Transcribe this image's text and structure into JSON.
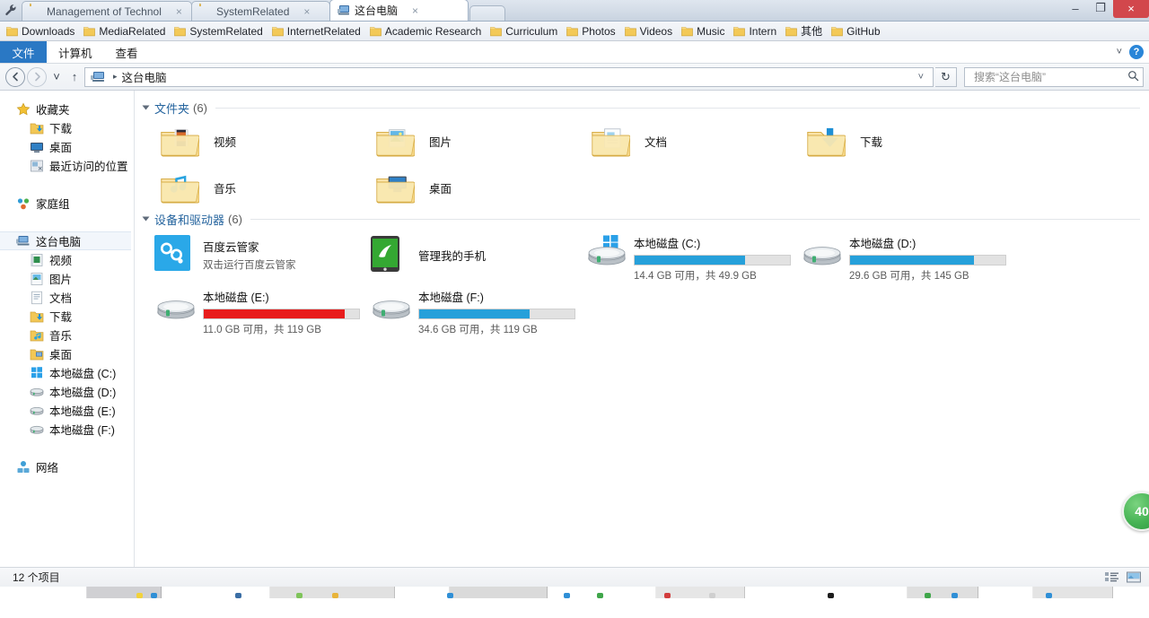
{
  "window": {
    "tabs": [
      {
        "title": "Management of Technol",
        "active": false,
        "icon": "folder-icon",
        "close": "×"
      },
      {
        "title": "SystemRelated",
        "active": false,
        "icon": "folder-icon",
        "close": "×"
      },
      {
        "title": "这台电脑",
        "active": true,
        "icon": "computer-icon",
        "close": "×"
      }
    ],
    "controls": {
      "minimize": "–",
      "maximize": "❐",
      "close": "×"
    },
    "wrench_icon": "wrench-icon"
  },
  "favorites_bar": {
    "items": [
      "Downloads",
      "MediaRelated",
      "SystemRelated",
      "InternetRelated",
      "Academic Research",
      "Curriculum",
      "Photos",
      "Videos",
      "Music",
      "Intern",
      "其他",
      "GitHub"
    ]
  },
  "menubar": {
    "file": "文件",
    "items": [
      "计算机",
      "查看"
    ],
    "expand_chevron": "˅",
    "help": "?"
  },
  "addressbar": {
    "back": "←",
    "forward": "→",
    "recent": "˅",
    "up": "↑",
    "crumb_icon": "computer-icon",
    "crumb_sep": "▸",
    "crumb_text": "这台电脑",
    "crumb_chevron": "˅",
    "refresh": "↻",
    "search_placeholder": "搜索“这台电脑”",
    "search_value": "",
    "search_icon": "magnifier-icon"
  },
  "navpane": {
    "sections": [
      {
        "header": {
          "label": "收藏夹",
          "icon": "star-icon"
        },
        "children": [
          {
            "label": "下载",
            "icon": "download-folder-icon"
          },
          {
            "label": "桌面",
            "icon": "desktop-icon"
          },
          {
            "label": "最近访问的位置",
            "icon": "recent-places-icon"
          }
        ]
      },
      {
        "header": {
          "label": "家庭组",
          "icon": "homegroup-icon"
        },
        "children": []
      },
      {
        "header": {
          "label": "这台电脑",
          "icon": "computer-icon",
          "selected": true
        },
        "children": [
          {
            "label": "视频",
            "icon": "videos-icon"
          },
          {
            "label": "图片",
            "icon": "pictures-icon"
          },
          {
            "label": "文档",
            "icon": "documents-icon"
          },
          {
            "label": "下载",
            "icon": "downloads-icon"
          },
          {
            "label": "音乐",
            "icon": "music-icon"
          },
          {
            "label": "桌面",
            "icon": "desktop-folder-icon"
          },
          {
            "label": "本地磁盘 (C:)",
            "icon": "windows-drive-icon"
          },
          {
            "label": "本地磁盘 (D:)",
            "icon": "drive-icon"
          },
          {
            "label": "本地磁盘 (E:)",
            "icon": "drive-icon"
          },
          {
            "label": "本地磁盘 (F:)",
            "icon": "drive-icon"
          }
        ]
      },
      {
        "header": {
          "label": "网络",
          "icon": "network-icon"
        },
        "children": []
      }
    ]
  },
  "content": {
    "groups": [
      {
        "title": "文件夹",
        "count": "(6)",
        "kind": "folders",
        "items": [
          {
            "label": "视频",
            "icon": "videos-folder-icon"
          },
          {
            "label": "图片",
            "icon": "pictures-folder-icon"
          },
          {
            "label": "文档",
            "icon": "documents-folder-icon"
          },
          {
            "label": "下载",
            "icon": "downloads-folder-icon"
          },
          {
            "label": "音乐",
            "icon": "music-folder-icon"
          },
          {
            "label": "桌面",
            "icon": "desktop-folder-icon"
          }
        ]
      },
      {
        "title": "设备和驱动器",
        "count": "(6)",
        "kind": "drives",
        "items": [
          {
            "type": "app",
            "name": "百度云管家",
            "desc": "双击运行百度云管家",
            "icon": "baidu-cloud-icon",
            "icon_color": "#2aa8e8"
          },
          {
            "type": "app",
            "name": "管理我的手机",
            "desc": "",
            "icon": "phone-manager-icon",
            "icon_color": "#34a832"
          },
          {
            "type": "drive",
            "name": "本地磁盘 (C:)",
            "free": "14.4 GB",
            "total": "49.9 GB",
            "sub": "14.4 GB 可用，共 49.9 GB",
            "used_percent": 71,
            "bar_color": "#26a0da",
            "icon": "windows-drive-icon"
          },
          {
            "type": "drive",
            "name": "本地磁盘 (D:)",
            "free": "29.6 GB",
            "total": "145 GB",
            "sub": "29.6 GB 可用，共 145 GB",
            "used_percent": 80,
            "bar_color": "#26a0da",
            "icon": "drive-icon"
          },
          {
            "type": "drive",
            "name": "本地磁盘 (E:)",
            "free": "11.0 GB",
            "total": "119 GB",
            "sub": "11.0 GB 可用，共 119 GB",
            "used_percent": 91,
            "bar_color": "#e81c1c",
            "icon": "drive-icon"
          },
          {
            "type": "drive",
            "name": "本地磁盘 (F:)",
            "free": "34.6 GB",
            "total": "119 GB",
            "sub": "34.6 GB 可用，共 119 GB",
            "used_percent": 71,
            "bar_color": "#26a0da",
            "icon": "drive-icon"
          }
        ]
      }
    ],
    "floating_badge": {
      "text": "40",
      "color": "#46b354"
    }
  },
  "statusbar": {
    "item_count": "12 个项目",
    "view_details": "details-view-icon",
    "view_large": "large-icons-view-icon"
  }
}
